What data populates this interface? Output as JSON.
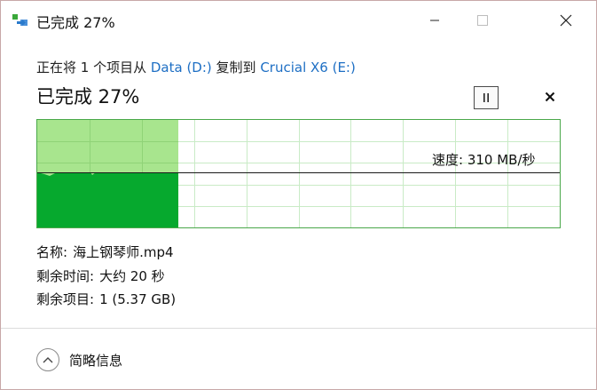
{
  "window": {
    "title": "已完成 27%",
    "accent_color": "#1e6fc4"
  },
  "copy": {
    "prefix": "正在将 1 个项目从 ",
    "source": "Data (D:)",
    "middle": " 复制到 ",
    "destination": "Crucial X6 (E:)"
  },
  "progress": {
    "headline": "已完成 27%",
    "percent": 27,
    "speed_text": "速度: 310 MB/秒",
    "fill_color": "#06a92e",
    "area_color": "#a8e58e",
    "grid_color": "#c9ebc6"
  },
  "details": {
    "name_label": "名称:",
    "name_value": "海上钢琴师.mp4",
    "time_label": "剩余时间:",
    "time_value": "大约 20 秒",
    "items_label": "剩余项目:",
    "items_value": "1 (5.37 GB)"
  },
  "footer": {
    "toggle_label": "简略信息"
  }
}
